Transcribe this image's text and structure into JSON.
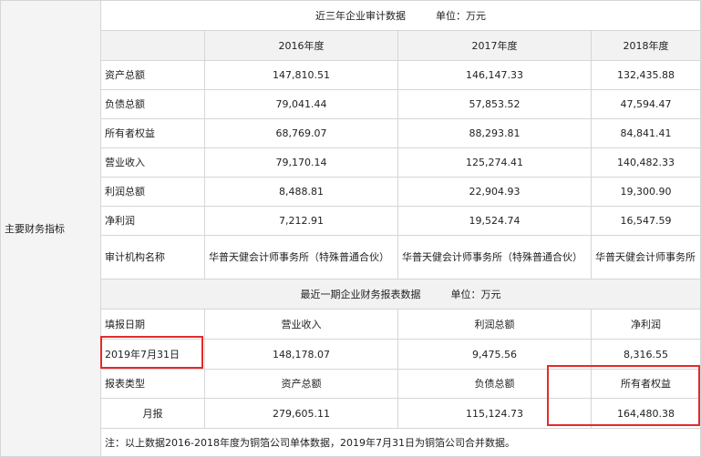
{
  "side_label": "主要财务指标",
  "audit": {
    "title": "近三年企业审计数据",
    "unit": "单位：万元",
    "years": [
      "2016年度",
      "2017年度",
      "2018年度"
    ],
    "rows": [
      {
        "label": "资产总额",
        "values": [
          "147,810.51",
          "146,147.33",
          "132,435.88"
        ]
      },
      {
        "label": "负债总额",
        "values": [
          "79,041.44",
          "57,853.52",
          "47,594.47"
        ]
      },
      {
        "label": "所有者权益",
        "values": [
          "68,769.07",
          "88,293.81",
          "84,841.41"
        ]
      },
      {
        "label": "营业收入",
        "values": [
          "79,170.14",
          "125,274.41",
          "140,482.33"
        ]
      },
      {
        "label": "利润总额",
        "values": [
          "8,488.81",
          "22,904.93",
          "19,300.90"
        ]
      },
      {
        "label": "净利润",
        "values": [
          "7,212.91",
          "19,524.74",
          "16,547.59"
        ]
      }
    ],
    "auditor_label": "审计机构名称",
    "auditor_values": [
      "华普天健会计师事务所（特殊普通合伙）",
      "华普天健会计师事务所（特殊普通合伙）",
      "华普天健会计师事务所（特殊普通合伙）"
    ]
  },
  "recent": {
    "title": "最近一期企业财务报表数据",
    "unit": "单位：万元",
    "header1": {
      "label": "填报日期",
      "cols": [
        "营业收入",
        "利润总额",
        "净利润"
      ]
    },
    "row1": {
      "label": "2019年7月31日",
      "values": [
        "148,178.07",
        "9,475.56",
        "8,316.55"
      ]
    },
    "header2": {
      "label": "报表类型",
      "cols": [
        "资产总额",
        "负债总额",
        "所有者权益"
      ]
    },
    "row2": {
      "label": "月报",
      "values": [
        "279,605.11",
        "115,124.73",
        "164,480.38"
      ]
    }
  },
  "note": "注：以上数据2016-2018年度为铜箔公司单体数据，2019年7月31日为铜箔公司合并数据。",
  "highlight_color": "#e52a2a"
}
